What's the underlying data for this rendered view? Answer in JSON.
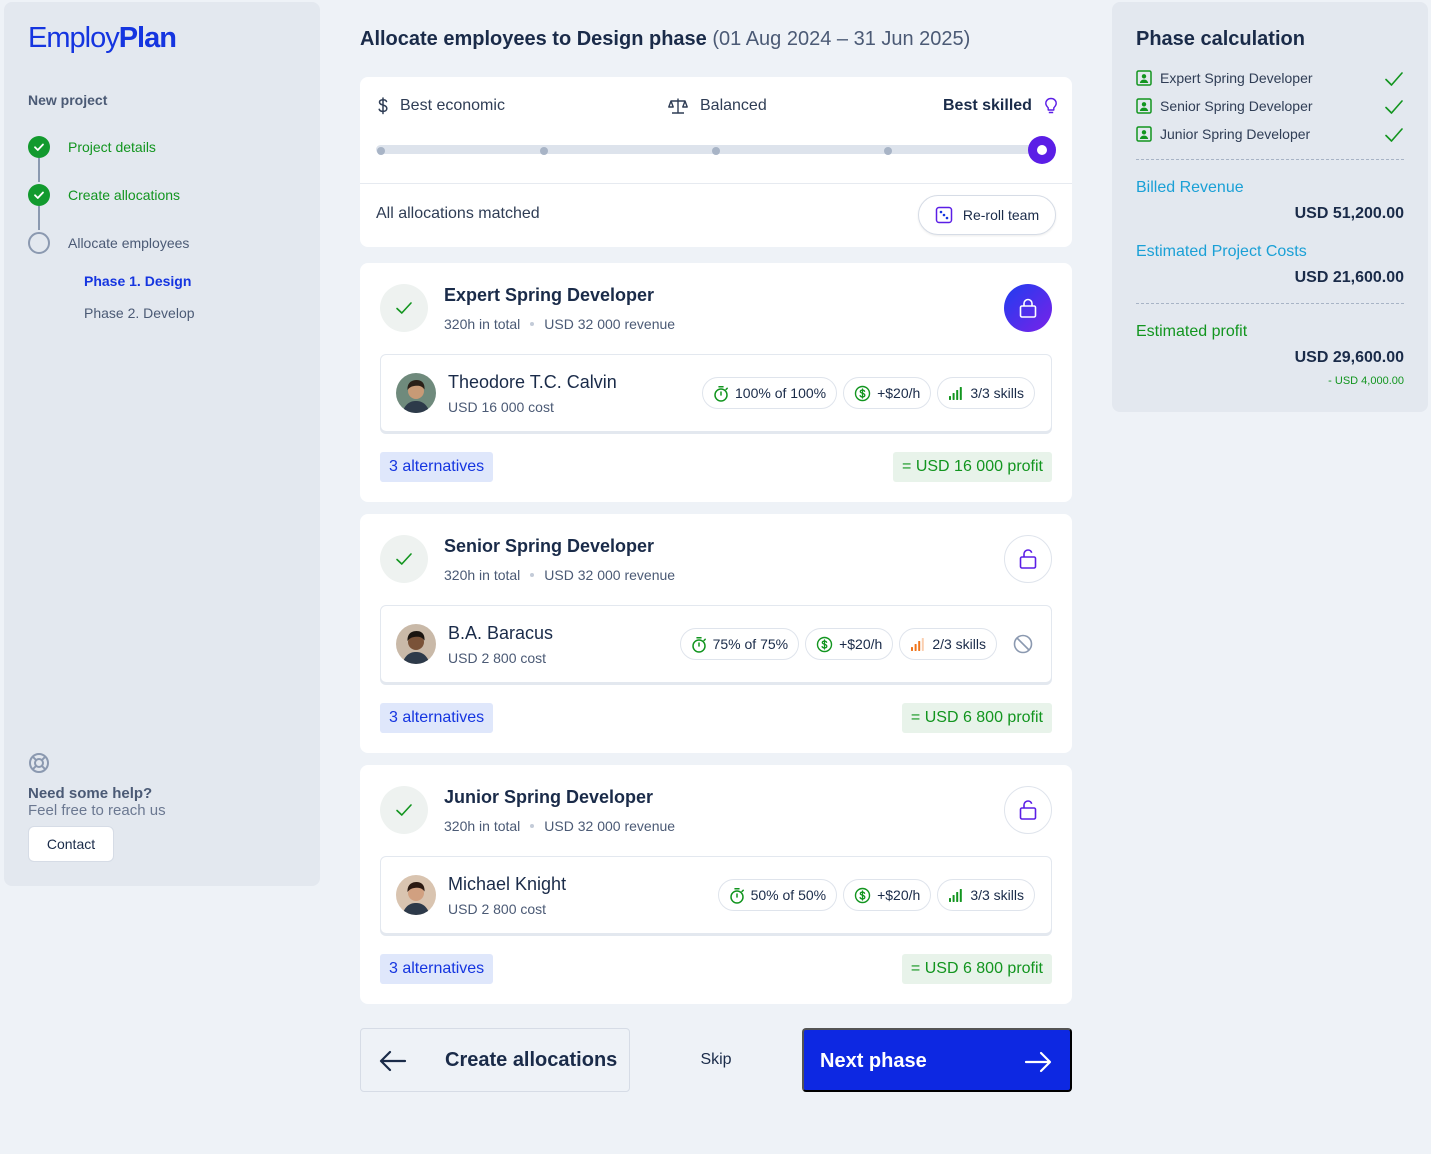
{
  "sidebar": {
    "logo_light": "Employ",
    "logo_bold": "Plan",
    "section_title": "New project",
    "steps": [
      {
        "label": "Project details",
        "state": "done"
      },
      {
        "label": "Create allocations",
        "state": "done"
      },
      {
        "label": "Allocate employees",
        "state": "todo"
      }
    ],
    "phases": [
      {
        "label": "Phase 1. Design",
        "active": true
      },
      {
        "label": "Phase 2. Develop",
        "active": false
      }
    ],
    "help": {
      "title": "Need some help?",
      "subtitle": "Feel free to reach us",
      "contact_label": "Contact"
    }
  },
  "header": {
    "title": "Allocate employees to Design phase",
    "date_range": "(01 Aug 2024 – 31 Jun 2025)"
  },
  "strategy": {
    "options": [
      "Best economic",
      "Balanced",
      "Best skilled"
    ],
    "selected": "Best skilled",
    "status": "All allocations matched",
    "reroll_label": "Re-roll team"
  },
  "allocations": [
    {
      "role": "Expert  Spring Developer",
      "hours": "320h in total",
      "revenue": "USD 32 000 revenue",
      "locked": true,
      "employee": {
        "name": "Theodore T.C. Calvin",
        "cost": "USD 16 000 cost",
        "availability": "100% of 100%",
        "rate": "+$20/h",
        "skills": "3/3 skills",
        "skills_level": "full",
        "blocked": false
      },
      "alternatives": "3 alternatives",
      "profit": "= USD 16 000 profit"
    },
    {
      "role": "Senior  Spring Developer",
      "hours": "320h in total",
      "revenue": "USD 32 000 revenue",
      "locked": false,
      "employee": {
        "name": "B.A. Baracus",
        "cost": "USD 2 800 cost",
        "availability": "75% of 75%",
        "rate": "+$20/h",
        "skills": "2/3 skills",
        "skills_level": "partial",
        "blocked": true
      },
      "alternatives": "3 alternatives",
      "profit": "= USD 6 800 profit"
    },
    {
      "role": "Junior  Spring Developer",
      "hours": "320h in total",
      "revenue": "USD 32 000 revenue",
      "locked": false,
      "employee": {
        "name": "Michael Knight",
        "cost": "USD 2 800 cost",
        "availability": "50% of 50%",
        "rate": "+$20/h",
        "skills": "3/3 skills",
        "skills_level": "full",
        "blocked": false
      },
      "alternatives": "3 alternatives",
      "profit": "= USD 6 800 profit"
    }
  ],
  "footer": {
    "back_label": "Create allocations",
    "skip_label": "Skip",
    "next_label": "Next phase"
  },
  "calculation": {
    "title": "Phase calculation",
    "roles": [
      "Expert Spring Developer",
      "Senior Spring Developer",
      "Junior Spring Developer"
    ],
    "billed_revenue_label": "Billed Revenue",
    "billed_revenue_value": "USD 51,200.00",
    "costs_label": "Estimated Project Costs",
    "costs_value": "USD 21,600.00",
    "profit_label": "Estimated profit",
    "profit_value": "USD 29,600.00",
    "profit_delta": "- USD 4,000.00"
  },
  "colors": {
    "brand": "#1535e0",
    "success": "#12951f",
    "accent_purple": "#5b1ee6",
    "info": "#1aa0d6"
  }
}
